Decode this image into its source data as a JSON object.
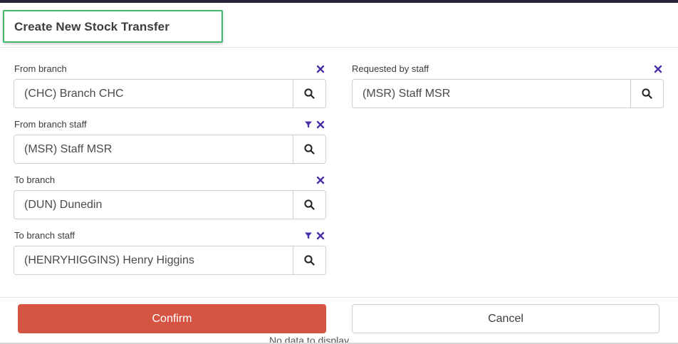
{
  "dialog": {
    "title": "Create New Stock Transfer"
  },
  "form": {
    "from_branch": {
      "label": "From branch",
      "value": "(CHC) Branch CHC"
    },
    "from_branch_staff": {
      "label": "From branch staff",
      "value": "(MSR) Staff MSR"
    },
    "to_branch": {
      "label": "To branch",
      "value": "(DUN) Dunedin"
    },
    "to_branch_staff": {
      "label": "To branch staff",
      "value": "(HENRYHIGGINS) Henry Higgins"
    },
    "requested_by_staff": {
      "label": "Requested by staff",
      "value": "(MSR) Staff MSR"
    }
  },
  "actions": {
    "confirm_label": "Confirm",
    "cancel_label": "Cancel"
  },
  "underlay": {
    "text": "No data to display"
  },
  "colors": {
    "accent_icon": "#4a2fa8",
    "confirm_bg": "#d55443",
    "title_border": "#3fb86b"
  }
}
